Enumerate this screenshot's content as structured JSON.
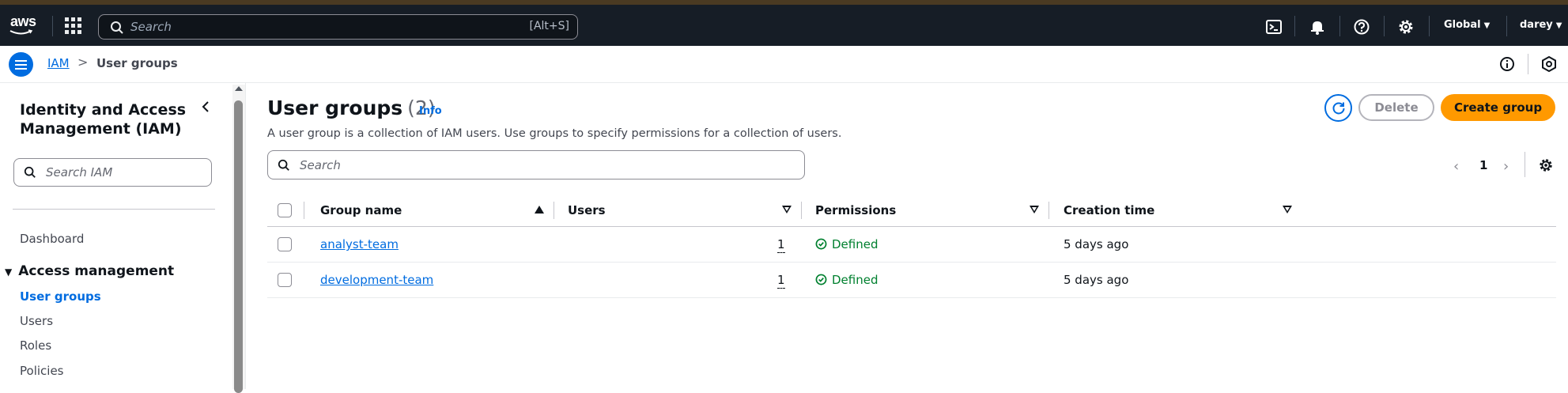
{
  "topnav": {
    "logo_text": "aws",
    "search_placeholder": "Search",
    "search_shortcut": "[Alt+S]",
    "region": "Global",
    "user": "darey"
  },
  "breadcrumb": {
    "service": "IAM",
    "current": "User groups"
  },
  "sidebar": {
    "title": "Identity and Access Management (IAM)",
    "search_placeholder": "Search IAM",
    "dashboard": "Dashboard",
    "section": "Access management",
    "items": [
      {
        "label": "User groups",
        "active": true
      },
      {
        "label": "Users",
        "active": false
      },
      {
        "label": "Roles",
        "active": false
      },
      {
        "label": "Policies",
        "active": false
      }
    ]
  },
  "main": {
    "title": "User groups",
    "count": "(2)",
    "info": "Info",
    "description": "A user group is a collection of IAM users. Use groups to specify permissions for a collection of users.",
    "refresh_icon": "refresh-icon",
    "delete_label": "Delete",
    "create_label": "Create group",
    "search_placeholder": "Search",
    "page": "1",
    "columns": [
      "Group name",
      "Users",
      "Permissions",
      "Creation time"
    ],
    "rows": [
      {
        "name": "analyst-team",
        "users": "1",
        "permissions": "Defined",
        "created": "5 days ago"
      },
      {
        "name": "development-team",
        "users": "1",
        "permissions": "Defined",
        "created": "5 days ago"
      }
    ]
  },
  "colors": {
    "nav_bg": "#161d26",
    "link": "#006ce0",
    "primary_button": "#ff9900",
    "success": "#00802f"
  }
}
